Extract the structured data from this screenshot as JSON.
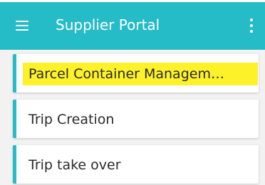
{
  "app_bar": {
    "title": "Supplier Portal",
    "menu_icon": "hamburger-menu-icon",
    "overflow_icon": "kebab-menu-icon",
    "color": "#26bcc7"
  },
  "list": {
    "items": [
      {
        "label": "Parcel Container Managem…",
        "highlighted": true
      },
      {
        "label": "Trip Creation",
        "highlighted": false
      },
      {
        "label": "Trip take over",
        "highlighted": false
      }
    ]
  },
  "colors": {
    "accent": "#26bcc7",
    "highlight": "#fdf22a"
  }
}
